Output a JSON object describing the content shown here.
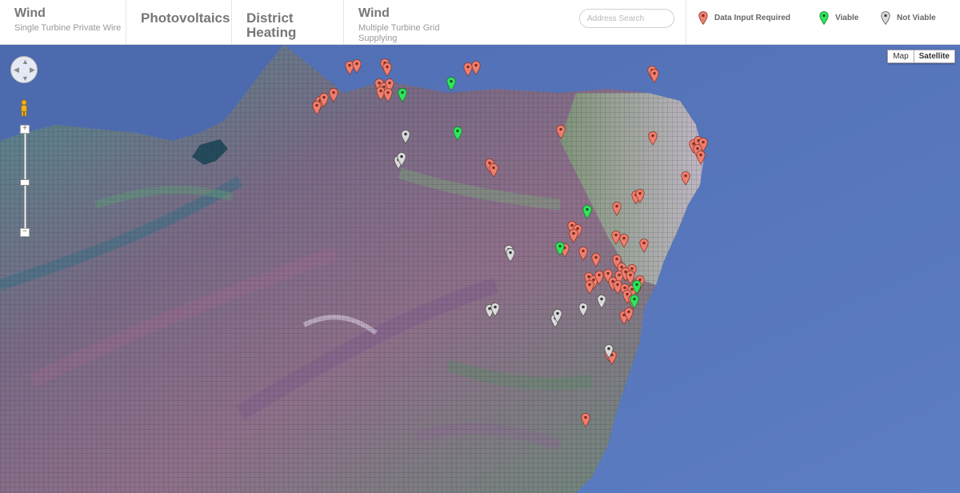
{
  "nav": {
    "tabs": [
      {
        "title": "Wind",
        "subtitle": "Single Turbine Private Wire"
      },
      {
        "title": "Photovoltaics"
      },
      {
        "title": "District Heating"
      },
      {
        "title": "Wind",
        "subtitle": "Multiple Turbine Grid Supplying"
      }
    ],
    "search_placeholder": "Address Search"
  },
  "legend": [
    {
      "label": "Data Input Required",
      "color": "#f07e6e",
      "icon": "map-pin-red-icon"
    },
    {
      "label": "Viable",
      "color": "#2ee65a",
      "icon": "map-pin-green-icon"
    },
    {
      "label": "Not Viable",
      "color": "#d9d9d9",
      "icon": "map-pin-grey-icon"
    }
  ],
  "map": {
    "map_type_options": [
      "Map",
      "Satellite"
    ],
    "selected_map_type": "Satellite",
    "zoom_in_label": "+",
    "zoom_out_label": "−"
  }
}
